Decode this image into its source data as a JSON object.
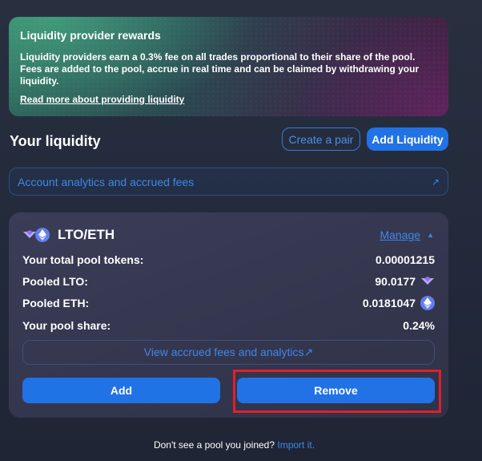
{
  "banner": {
    "title": "Liquidity provider rewards",
    "text": "Liquidity providers earn a 0.3% fee on all trades proportional to their share of the pool. Fees are added to the pool, accrue in real time and can be claimed by withdrawing your liquidity.",
    "link": "Read more about providing liquidity"
  },
  "header": {
    "title": "Your liquidity",
    "create_pair": "Create a pair",
    "add_liquidity": "Add Liquidity"
  },
  "analytics": {
    "label": "Account analytics and accrued fees",
    "arrow": "↗"
  },
  "pool": {
    "pair": "LTO/ETH",
    "manage": "Manage",
    "manage_chevron": "▲",
    "stats": [
      {
        "label": "Your total pool tokens:",
        "value": "0.00001215"
      },
      {
        "label": "Pooled LTO:",
        "value": "90.0177",
        "icon": "lto-icon"
      },
      {
        "label": "Pooled ETH:",
        "value": "0.0181047",
        "icon": "eth-icon"
      },
      {
        "label": "Your pool share:",
        "value": "0.24%"
      }
    ],
    "view_fees": "View accrued fees and analytics↗",
    "add_button": "Add",
    "remove_button": "Remove"
  },
  "footer": {
    "text": "Don't see a pool you joined? ",
    "link": "Import it."
  },
  "colors": {
    "accent": "#2172e5",
    "link": "#3f87e8",
    "highlight": "#e0202a",
    "eth": "#627eea"
  }
}
